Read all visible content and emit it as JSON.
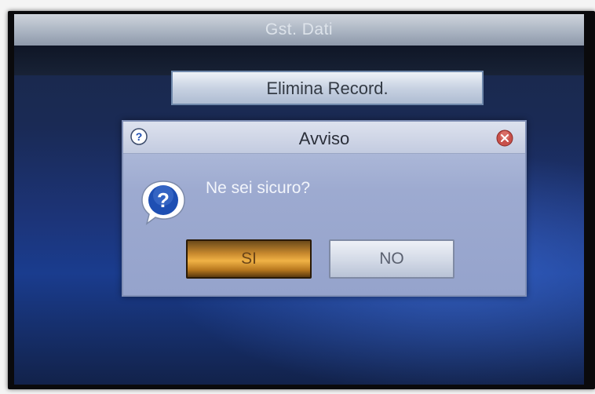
{
  "screen": {
    "title": "Gst. Dati",
    "record_bar_label": "Elimina Record."
  },
  "dialog": {
    "title": "Avviso",
    "message": "Ne sei sicuro?",
    "title_icon": "help-icon",
    "close_icon": "close-icon",
    "body_icon": "question-bubble-icon",
    "buttons": {
      "yes_label": "SI",
      "no_label": "NO"
    }
  },
  "colors": {
    "accent_yes": "#f0b246",
    "close_red": "#c8504a",
    "question_blue": "#1e4fb3"
  }
}
